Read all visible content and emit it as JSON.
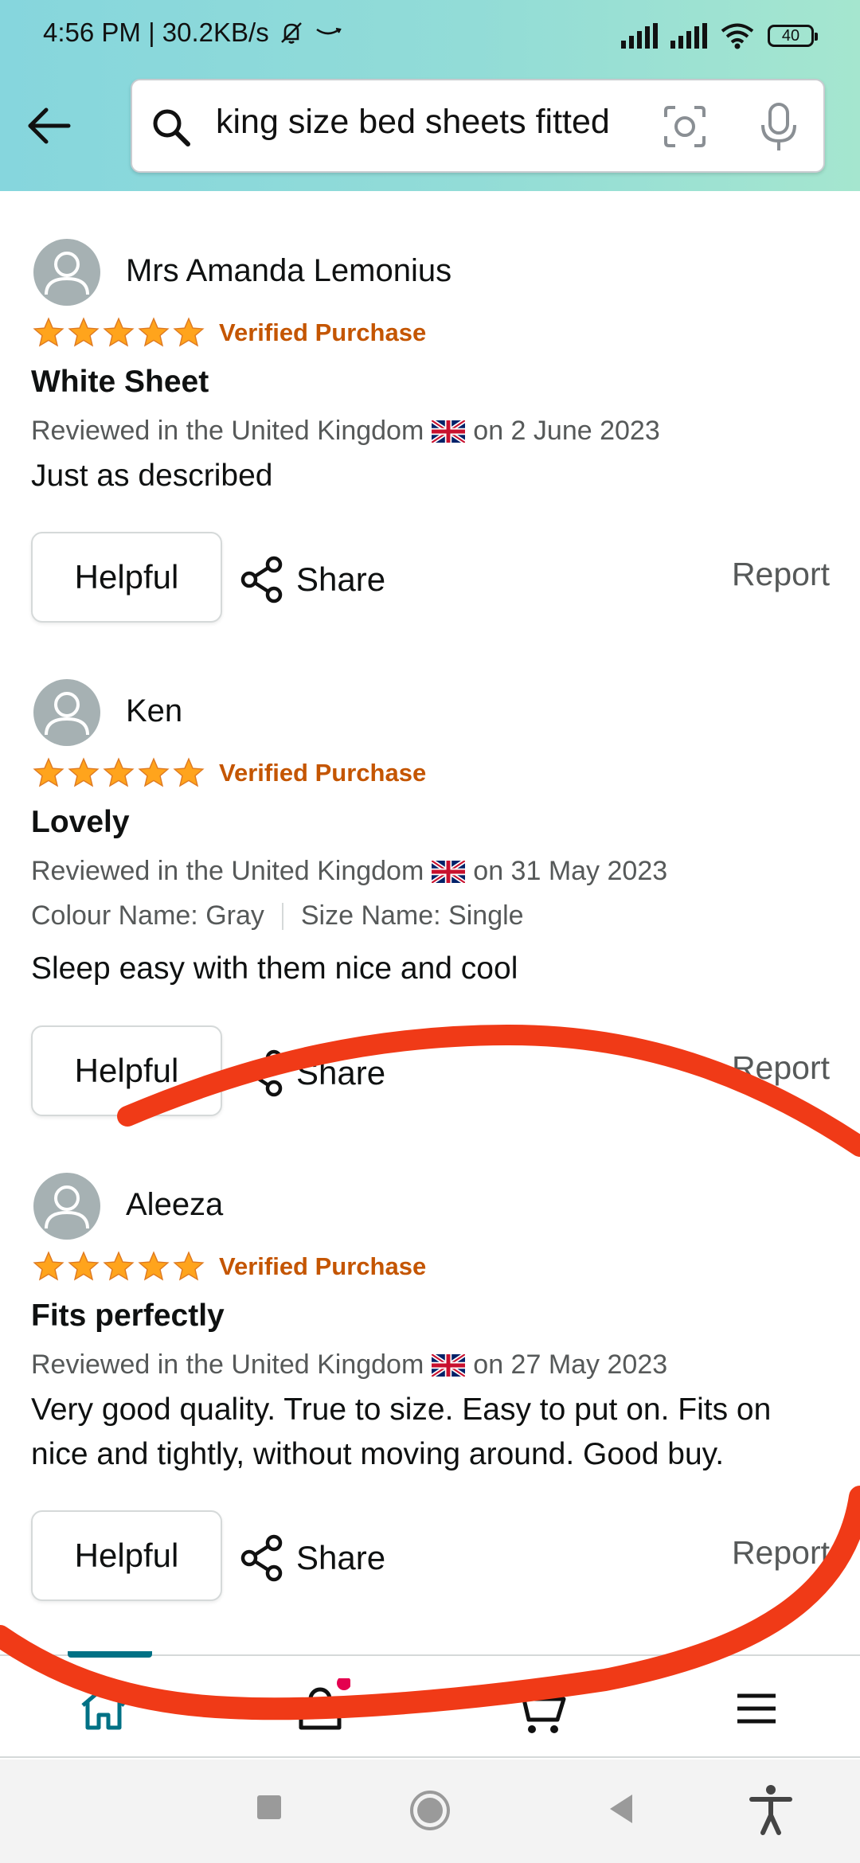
{
  "status_bar": {
    "time_speed": "4:56 PM | 30.2KB/s",
    "battery": "40"
  },
  "search": {
    "query": "king size bed sheets fitted"
  },
  "reviews": [
    {
      "name": "Mrs Amanda Lemonius",
      "rating": 5,
      "verified": "Verified Purchase",
      "title": "White Sheet",
      "meta_prefix": "Reviewed in the United Kingdom",
      "meta_date": "on 2 June 2023",
      "colour": "",
      "size": "",
      "body": "Just as described",
      "helpful_label": "Helpful",
      "share_label": "Share",
      "report_label": "Report"
    },
    {
      "name": "Ken",
      "rating": 5,
      "verified": "Verified Purchase",
      "title": "Lovely",
      "meta_prefix": "Reviewed in the United Kingdom",
      "meta_date": "on 31 May 2023",
      "colour": "Colour Name: Gray",
      "size": "Size Name: Single",
      "body": "Sleep easy with them nice and cool",
      "helpful_label": "Helpful",
      "share_label": "Share",
      "report_label": "Report"
    },
    {
      "name": "Aleeza",
      "rating": 5,
      "verified": "Verified Purchase",
      "title": "Fits perfectly",
      "meta_prefix": "Reviewed in the United Kingdom",
      "meta_date": "on 27 May 2023",
      "colour": "",
      "size": "",
      "body": "Very good quality. True to size. Easy to put on. Fits on nice and tightly, without moving around. Good buy.",
      "helpful_label": "Helpful",
      "share_label": "Share",
      "report_label": "Report"
    }
  ],
  "colors": {
    "accent_teal": "#007185",
    "star": "#ffa41c",
    "verified": "#c45500",
    "annotation_red": "#f03a17"
  },
  "icons": {
    "nav": [
      "home-icon",
      "account-icon",
      "cart-icon",
      "menu-icon"
    ],
    "system": [
      "recents-icon",
      "home-button-icon",
      "back-triangle-icon",
      "accessibility-icon"
    ]
  }
}
